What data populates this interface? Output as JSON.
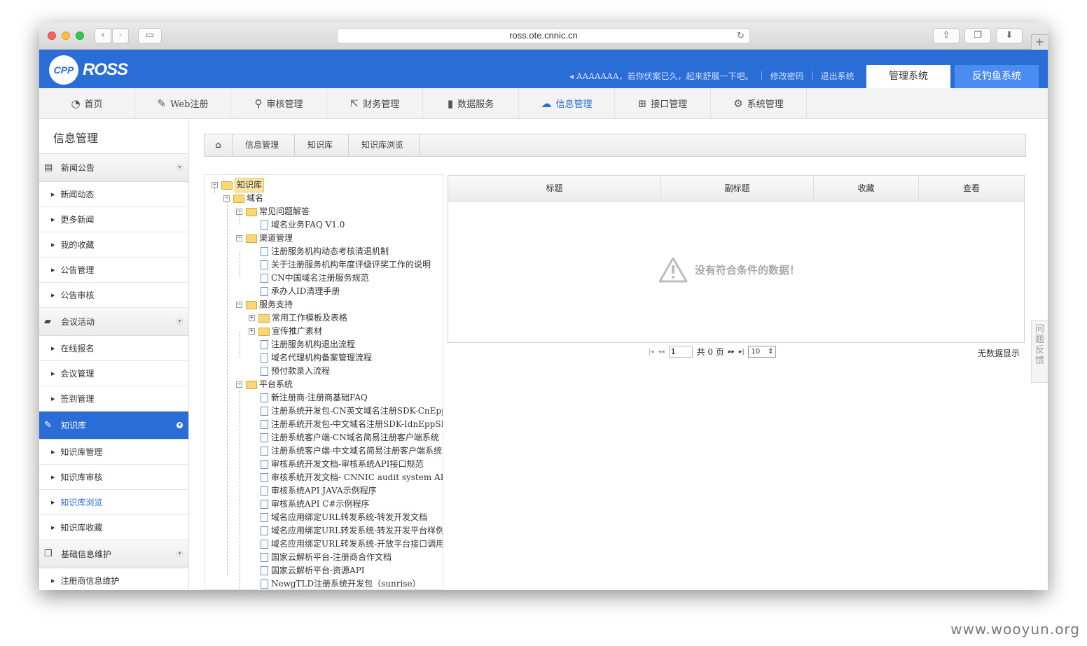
{
  "browser": {
    "url": "ross.ote.cnnic.cn"
  },
  "header": {
    "logo_badge": "CPP",
    "logo_text": "ROSS",
    "greeting": "AAAAAAA，若你伏案已久，起来舒展一下吧。",
    "change_password": "修改密码",
    "logout": "退出系统",
    "system_tabs": [
      "管理系统",
      "反钓鱼系统"
    ]
  },
  "mainnav": [
    {
      "label": "首页",
      "icon": "dashboard-icon",
      "glyph": "◔"
    },
    {
      "label": "Web注册",
      "icon": "edit-icon",
      "glyph": "✎"
    },
    {
      "label": "审核管理",
      "icon": "search-icon",
      "glyph": "⚲"
    },
    {
      "label": "财务管理",
      "icon": "external-link-icon",
      "glyph": "⇱"
    },
    {
      "label": "数据服务",
      "icon": "bar-chart-icon",
      "glyph": "▮"
    },
    {
      "label": "信息管理",
      "icon": "comments-icon",
      "glyph": "☁"
    },
    {
      "label": "接口管理",
      "icon": "sitemap-icon",
      "glyph": "⊞"
    },
    {
      "label": "系统管理",
      "icon": "gears-icon",
      "glyph": "⚙"
    }
  ],
  "sidebar": {
    "title": "信息管理",
    "groups": [
      {
        "label": "新闻公告",
        "icon": "comment-icon",
        "glyph": "▤",
        "items": [
          "新闻动态",
          "更多新闻",
          "我的收藏",
          "公告管理",
          "公告审核"
        ]
      },
      {
        "label": "会议活动",
        "icon": "comments-icon",
        "glyph": "▰",
        "items": [
          "在线报名",
          "会议管理",
          "签到管理"
        ]
      },
      {
        "label": "知识库",
        "icon": "edit-icon",
        "glyph": "✎",
        "items": [
          "知识库管理",
          "知识库审核",
          "知识库浏览",
          "知识库收藏"
        ]
      },
      {
        "label": "基础信息维护",
        "icon": "copy-icon",
        "glyph": "❐",
        "items": [
          "注册商信息维护"
        ]
      }
    ]
  },
  "breadcrumb": [
    "信息管理",
    "知识库",
    "知识库浏览"
  ],
  "tree": [
    {
      "level": 0,
      "type": "folder",
      "toggle": "−",
      "label": "知识库",
      "selected": true
    },
    {
      "level": 1,
      "type": "folder",
      "toggle": "−",
      "label": "域名"
    },
    {
      "level": 2,
      "type": "folder",
      "toggle": "−",
      "label": "常见问题解答"
    },
    {
      "level": 3,
      "type": "doc",
      "label": "域名业务FAQ V1.0"
    },
    {
      "level": 2,
      "type": "folder",
      "toggle": "−",
      "label": "渠道管理"
    },
    {
      "level": 3,
      "type": "doc",
      "label": "注册服务机构动态考核清退机制"
    },
    {
      "level": 3,
      "type": "doc",
      "label": "关于注册服务机构年度评级评奖工作的说明"
    },
    {
      "level": 3,
      "type": "doc",
      "label": "CN中国域名注册服务规范"
    },
    {
      "level": 3,
      "type": "doc",
      "label": "承办人ID清理手册"
    },
    {
      "level": 2,
      "type": "folder",
      "toggle": "−",
      "label": "服务支持"
    },
    {
      "level": 3,
      "type": "folder",
      "toggle": "+",
      "label": "常用工作模板及表格"
    },
    {
      "level": 3,
      "type": "folder",
      "toggle": "+",
      "label": "宣传推广素材"
    },
    {
      "level": 3,
      "type": "doc",
      "label": "注册服务机构退出流程"
    },
    {
      "level": 3,
      "type": "doc",
      "label": "域名代理机构备案管理流程"
    },
    {
      "level": 3,
      "type": "doc",
      "label": "预付款录入流程"
    },
    {
      "level": 2,
      "type": "folder",
      "toggle": "−",
      "label": "平台系统"
    },
    {
      "level": 3,
      "type": "doc",
      "label": "新注册商-注册商基础FAQ"
    },
    {
      "level": 3,
      "type": "doc",
      "label": "注册系统开发包-CN英文域名注册SDK-CnEppS"
    },
    {
      "level": 3,
      "type": "doc",
      "label": "注册系统开发包-中文域名注册SDK-IdnEppSDK"
    },
    {
      "level": 3,
      "type": "doc",
      "label": "注册系统客户端-CN域名简易注册客户端系统"
    },
    {
      "level": 3,
      "type": "doc",
      "label": "注册系统客户端-中文域名简易注册客户端系统"
    },
    {
      "level": 3,
      "type": "doc",
      "label": "审核系统开发文档-审核系统API接口规范"
    },
    {
      "level": 3,
      "type": "doc",
      "label": "审核系统开发文档- CNNIC audit system API man"
    },
    {
      "level": 3,
      "type": "doc",
      "label": "审核系统API JAVA示例程序"
    },
    {
      "level": 3,
      "type": "doc",
      "label": "审核系统API C#示例程序"
    },
    {
      "level": 3,
      "type": "doc",
      "label": "域名应用绑定URL转发系统-转发开发文档"
    },
    {
      "level": 3,
      "type": "doc",
      "label": "域名应用绑定URL转发系统-转发开发平台样例"
    },
    {
      "level": 3,
      "type": "doc",
      "label": "域名应用绑定URL转发系统-开放平台接口调用"
    },
    {
      "level": 3,
      "type": "doc",
      "label": "国家云解析平台-注册商合作文档"
    },
    {
      "level": 3,
      "type": "doc",
      "label": "国家云解析平台-资源API"
    },
    {
      "level": 3,
      "type": "doc",
      "label": "NewgTLD注册系统开发包（sunrise）"
    }
  ],
  "grid": {
    "columns": [
      "标题",
      "副标题",
      "收藏",
      "查看"
    ],
    "empty_message": "没有符合条件的数据！"
  },
  "pager": {
    "page": "1",
    "total_text": "共 0 页",
    "page_size": "10",
    "status": "无数据显示"
  },
  "feedback": "问题反馈",
  "watermark": "www.wooyun.org"
}
